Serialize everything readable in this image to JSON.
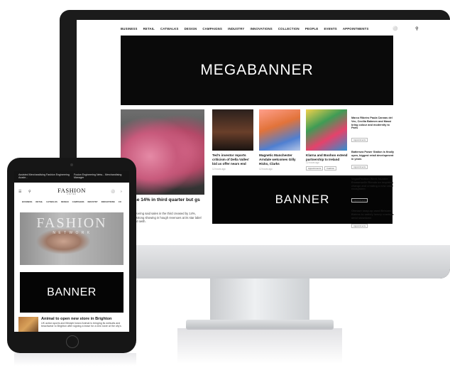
{
  "desktop": {
    "nav": [
      "BUSINESS",
      "RETAIL",
      "CATWALKS",
      "DESIGN",
      "CAMPAIGNS",
      "INDUSTRY",
      "INNOVATIONS",
      "COLLECTION",
      "PEOPLE",
      "EVENTS",
      "APPOINTMENTS"
    ],
    "megabanner": "MEGABANNER",
    "banner": "BANNER",
    "hero": {
      "title": "ales rise 14% in third quarter but gs",
      "text": "xury group Kering said sales in the third creased by 14%, driven by a strong showing in hough revenues at its star label Gucci lagged owth."
    },
    "cards": [
      {
        "title": "Ted's investor reports criticism of Della Valles' bid as offer nears end",
        "meta": "12 hours ago"
      },
      {
        "title": "Magnetic Manchester Arndale welcomes Gilly Hicks, Clarks",
        "meta": "12 hours ago"
      },
      {
        "title": "Klarna and Boohoo extend partnership to Ireland",
        "meta": "12 hours ago",
        "tags": [
          "Appointments",
          "Fashion"
        ]
      }
    ],
    "sidebar": [
      {
        "title": "Marco Ribeiro Paula Cannas del Vec, Cecilia Bahmen and Massi bring colour and modernity to Paris",
        "tag": "Appointments"
      },
      {
        "title": "Battersea Power Station is finally open, biggest retail development in years",
        "tag": "Appointments"
      },
      {
        "title": "VeganFashion Week founder Emmanuelle Rienda on inspiring change and creating a new value ecosystem",
        "tag": "Appointments"
      },
      {
        "title": "Ohmaze snap-up used Beisons, Birkins to satisfy luxury cravings amid slowdown",
        "tag": "Appointments"
      }
    ]
  },
  "tablet": {
    "ads": [
      "Assisted Merchandising Fashion Engineering Acade...",
      "Fusion Engineering Netw... Merchandising Manager"
    ],
    "logo": "FASHION",
    "logo_sub": "UNITED",
    "nav": [
      "BUSINESS",
      "RETAIL",
      "CATWALKS",
      "DESIGN",
      "CAMPAIGNS",
      "INDUSTRY",
      "INNOVATIONS",
      "CO"
    ],
    "hero_text": "FASHION",
    "hero_sub": "N E T W O R K",
    "banner": "BANNER",
    "article": {
      "title": "Animal to open new store in Brighton",
      "text": "UK action sports and lifestyle brand Animal is bringing its wetsuits and beachwear to Brighton after signing a lease for a new store at the city's"
    }
  }
}
